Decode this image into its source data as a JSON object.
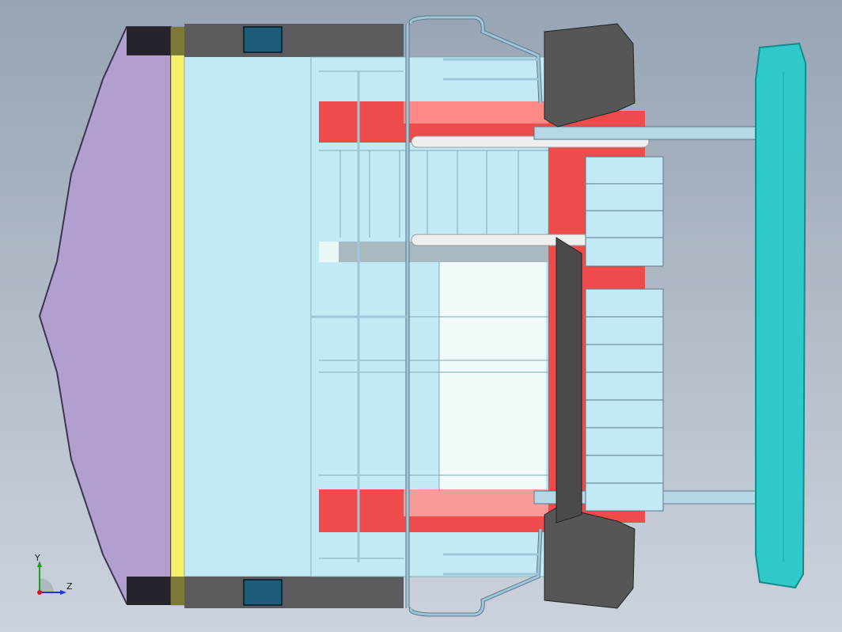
{
  "viewport": {
    "background_top": "#97a4b4",
    "background_bottom": "#cdd3dd"
  },
  "triad": {
    "y_label": "Y",
    "z_label": "Z",
    "y_color": "#19a319",
    "z_color": "#2233dd",
    "x_color": "#d11"
  },
  "model": {
    "colors": {
      "nose": "#b19fcf",
      "nose_edge": "#3d3550",
      "stripe": "#f5f06a",
      "body": "#c3e9f5",
      "dark_panel": "#5b5b5f",
      "black_corner": "#26232d",
      "red_plate": "#ee4b4b",
      "red_light": "#f88",
      "white_face": "#f3fafc",
      "rail": "#9fc6d8",
      "rail_dark": "#5e7a8a",
      "bumper": "#2fc9c9",
      "bumper_edge": "#138c8c",
      "window": "#1c5c7a"
    }
  }
}
